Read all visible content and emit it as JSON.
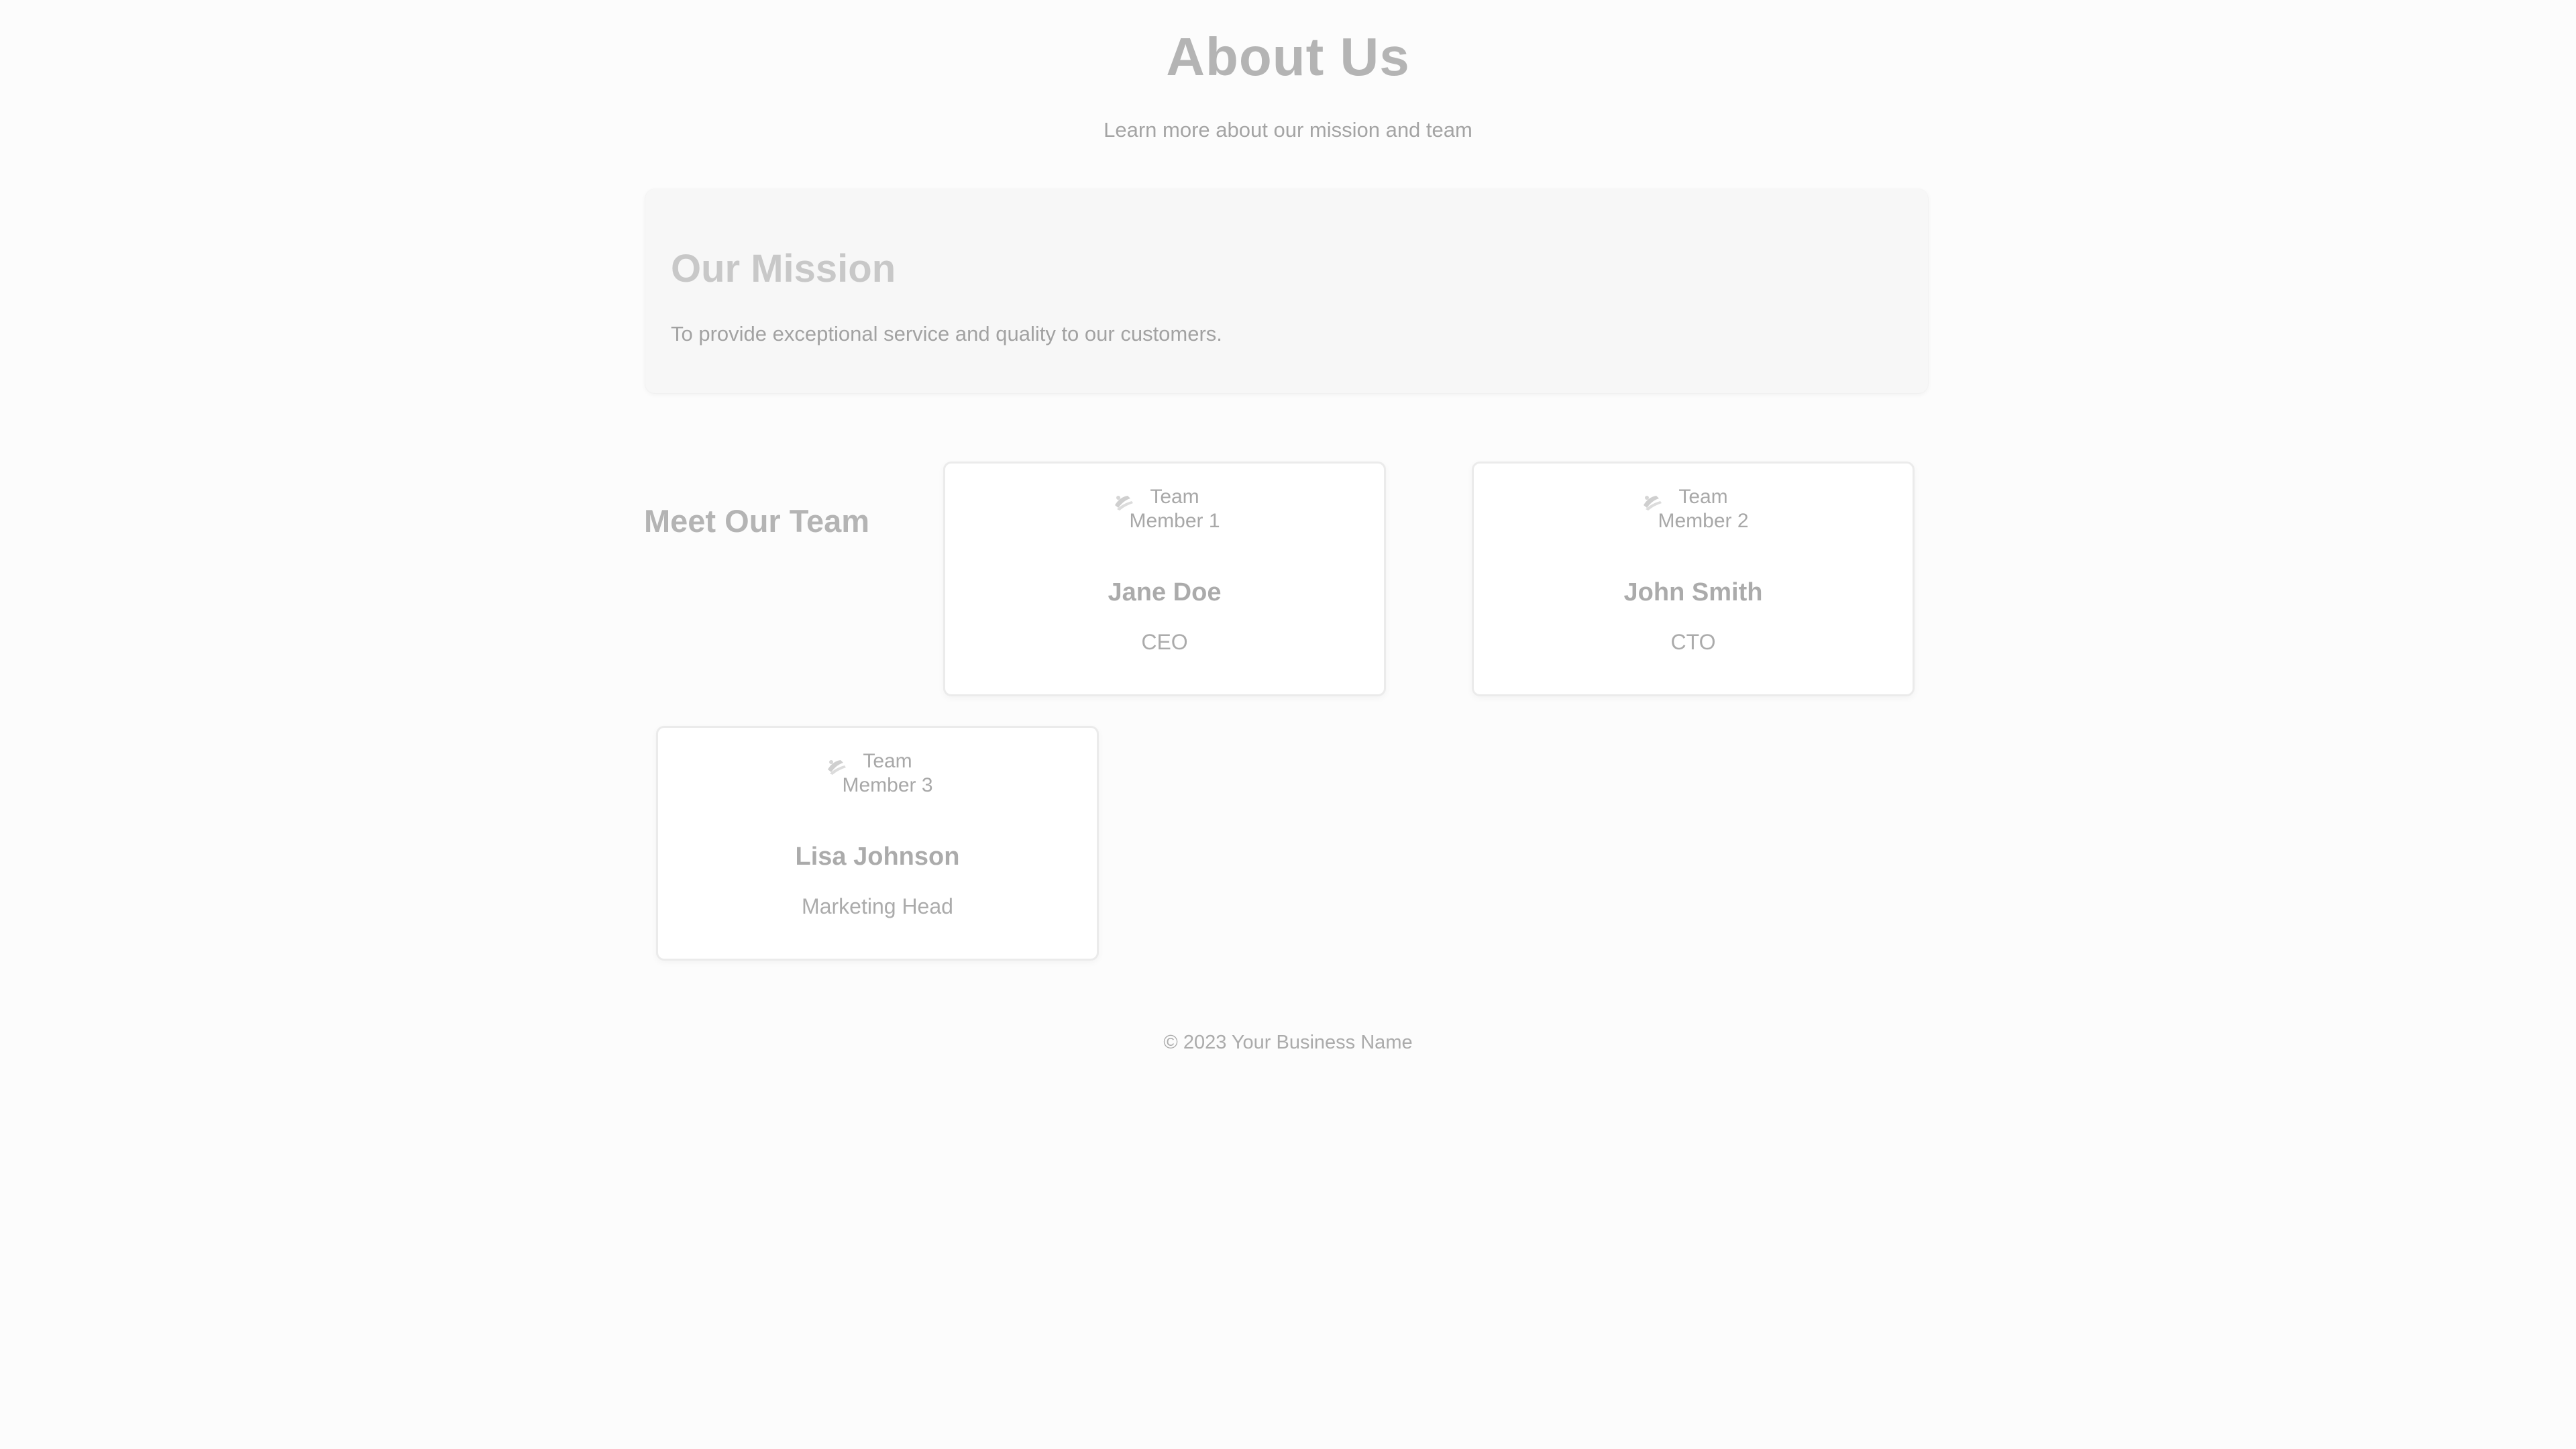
{
  "header": {
    "title": "About Us",
    "subtitle": "Learn more about our mission and team"
  },
  "mission": {
    "title": "Our Mission",
    "text": "To provide exceptional service and quality to our customers."
  },
  "team": {
    "heading": "Meet Our Team",
    "members": [
      {
        "photo_alt": "Team Member 1",
        "photo_icon": "broken-image-icon",
        "name": "Jane Doe",
        "role": "CEO"
      },
      {
        "photo_alt": "Team Member 2",
        "photo_icon": "broken-image-icon",
        "name": "John Smith",
        "role": "CTO"
      },
      {
        "photo_alt": "Team Member 3",
        "photo_icon": "broken-image-icon",
        "name": "Lisa Johnson",
        "role": "Marketing Head"
      }
    ]
  },
  "footer": {
    "text": "© 2023 Your Business Name"
  },
  "colors": {
    "background": "#fcfcfc",
    "heading": "#b4b4b4",
    "body_text": "#a4a4a4",
    "card_border": "#ebebeb",
    "mission_background": "#f7f7f7"
  }
}
